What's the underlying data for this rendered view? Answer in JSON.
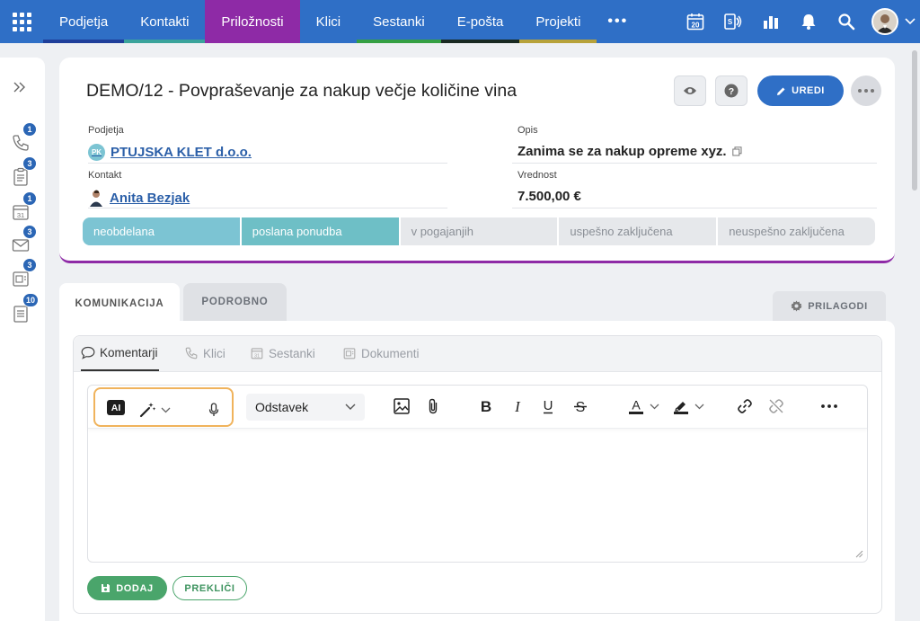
{
  "nav": {
    "tabs": [
      {
        "label": "Podjetja",
        "bar": "#1f3f9a"
      },
      {
        "label": "Kontakti",
        "bar": "#3aa39b"
      },
      {
        "label": "Priložnosti",
        "bar": "#8e2aa6"
      },
      {
        "label": "Klici",
        "bar": "#2f6fc6"
      },
      {
        "label": "Sestanki",
        "bar": "#35a043"
      },
      {
        "label": "E-pošta",
        "bar": "#1a2a22"
      },
      {
        "label": "Projekti",
        "bar": "#b7a23a"
      }
    ],
    "more": "•••",
    "calendar_day": "20",
    "accent": "#2f6fc6"
  },
  "sidebar": {
    "badges": [
      "1",
      "3",
      "1",
      "3",
      "3",
      "10"
    ],
    "calendar_day": "31"
  },
  "record": {
    "title": "DEMO/12 - Povpraševanje za nakup večje količine vina",
    "edit_label": "UREDI",
    "company_label": "Podjetja",
    "company_initials": "PK",
    "company_value": "PTUJSKA KLET d.o.o.",
    "contact_label": "Kontakt",
    "contact_value": "Anita Bezjak",
    "description_label": "Opis",
    "description_value": "Zanima se za nakup opreme xyz.",
    "value_label": "Vrednost",
    "value_value": "7.500,00 €",
    "stages": [
      "neobdelana",
      "poslana ponudba",
      "v pogajanjih",
      "uspešno zaključena",
      "neuspešno zaključena"
    ]
  },
  "tabs": {
    "communication": "KOMUNIKACIJA",
    "details": "PODROBNO",
    "customize": "PRILAGODI"
  },
  "subtabs": {
    "comments": "Komentarji",
    "calls": "Klici",
    "meetings": "Sestanki",
    "documents": "Dokumenti",
    "calendar_day": "31"
  },
  "editor": {
    "ai_label": "AI",
    "format_value": "Odstavek",
    "more": "•••"
  },
  "actions": {
    "add": "DODAJ",
    "cancel": "PREKLIČI"
  }
}
